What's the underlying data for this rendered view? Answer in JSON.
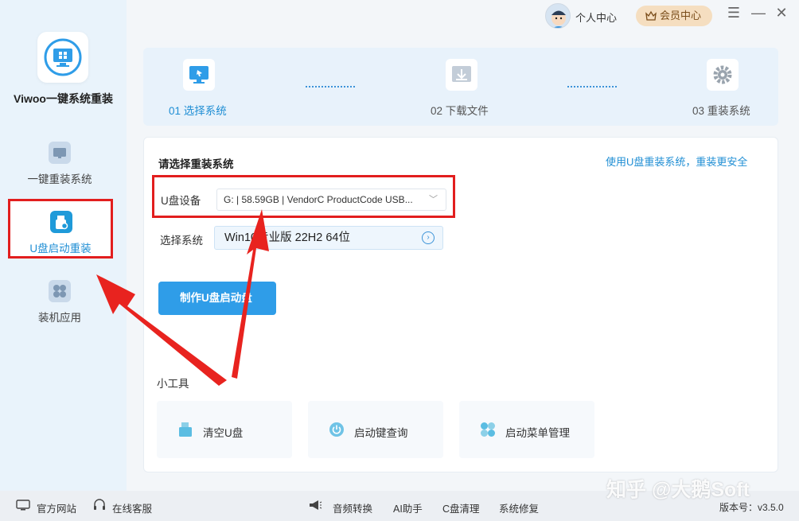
{
  "app": {
    "title": "Viwoo一键系统重装"
  },
  "sidebar": {
    "items": [
      {
        "label": "一键重装系统",
        "icon": "monitor-refresh-icon"
      },
      {
        "label": "U盘启动重装",
        "icon": "usb-drive-icon"
      },
      {
        "label": "装机应用",
        "icon": "apps-grid-icon"
      }
    ]
  },
  "header": {
    "user_center": "个人中心",
    "vip_center": "会员中心"
  },
  "steps": [
    {
      "label": "01 选择系统"
    },
    {
      "label": "02 下载文件"
    },
    {
      "label": "03 重装系统"
    }
  ],
  "main": {
    "section_title": "请选择重装系统",
    "safe_link": "使用U盘重装系统，重装更安全",
    "udisk_label": "U盘设备",
    "udisk_value": "G: | 58.59GB | VendorC ProductCode USB...",
    "system_label": "选择系统",
    "system_value": "Win10专业版 22H2 64位",
    "make_button": "制作U盘启动盘"
  },
  "tools": {
    "title": "小工具",
    "items": [
      {
        "label": "清空U盘"
      },
      {
        "label": "启动键查询"
      },
      {
        "label": "启动菜单管理"
      }
    ]
  },
  "footer": {
    "official_site": "官方网站",
    "online_service": "在线客服",
    "audio_convert": "音频转换",
    "ai_assistant": "AI助手",
    "c_clean": "C盘清理",
    "system_repair": "系统修复",
    "version": "版本号：v3.5.0"
  },
  "watermark": "知乎 @大鹅Soft",
  "colors": {
    "accent": "#1f8ed4",
    "highlight_border": "#e21e1e",
    "button": "#2f9de8"
  }
}
